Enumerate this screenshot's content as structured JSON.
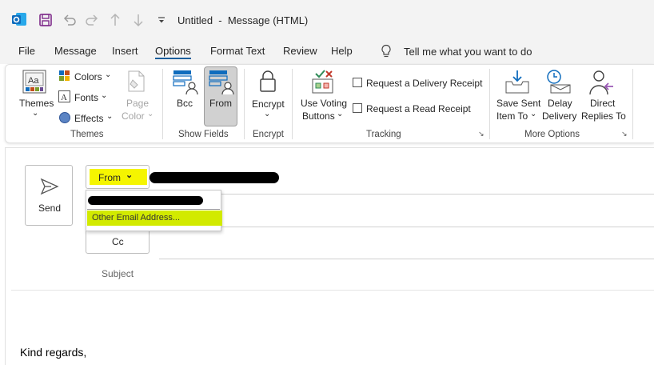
{
  "window": {
    "title": "Untitled  -  Message (HTML)"
  },
  "menu": {
    "file": "File",
    "message": "Message",
    "insert": "Insert",
    "options": "Options",
    "format_text": "Format Text",
    "review": "Review",
    "help": "Help",
    "tell_me": "Tell me what you want to do"
  },
  "ribbon": {
    "themes": {
      "themes": "Themes",
      "colors": "Colors",
      "fonts": "Fonts",
      "effects": "Effects",
      "page": "Page",
      "color": "Color",
      "group": "Themes"
    },
    "show_fields": {
      "bcc": "Bcc",
      "from": "From",
      "group": "Show Fields"
    },
    "encrypt": {
      "label": "Encrypt",
      "group": "Encrypt"
    },
    "tracking": {
      "use_voting": "Use Voting",
      "buttons": "Buttons",
      "delivery_receipt": "Request a Delivery Receipt",
      "read_receipt": "Request a Read Receipt",
      "group": "Tracking"
    },
    "more_options": {
      "save_sent": "Save Sent",
      "item_to": "Item To",
      "delay": "Delay",
      "delivery": "Delivery",
      "direct": "Direct",
      "replies_to": "Replies To",
      "group": "More Options"
    }
  },
  "compose": {
    "send": "Send",
    "from": "From",
    "cc": "Cc",
    "subject": "Subject",
    "dropdown_item": "Other Email Address...",
    "body": "Kind regards,"
  },
  "colors": {
    "accent": "#1b5e9c",
    "highlight_yellow": "#f5f500",
    "highlight_green": "#d2ea00",
    "outlook_blue": "#0f6cbd"
  }
}
